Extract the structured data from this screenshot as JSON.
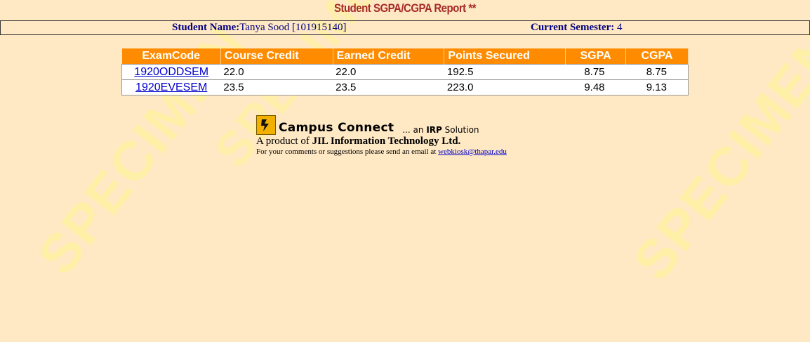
{
  "page": {
    "title": "Student SGPA/CGPA Report **",
    "watermark": "SPECIMEN"
  },
  "info": {
    "student_name_label": "Student Name:",
    "student_name_value": "Tanya Sood [101915140]",
    "semester_label": "Current Semester:",
    "semester_value": "4"
  },
  "table": {
    "headers": [
      "ExamCode",
      "Course Credit",
      "Earned Credit",
      "Points Secured",
      "SGPA",
      "CGPA"
    ],
    "rows": [
      {
        "exam_code": "1920ODDSEM",
        "course_credit": "22.0",
        "earned_credit": "22.0",
        "points_secured": "192.5",
        "sgpa": "8.75",
        "cgpa": "8.75"
      },
      {
        "exam_code": "1920EVESEM",
        "course_credit": "23.5",
        "earned_credit": "23.5",
        "points_secured": "223.0",
        "sgpa": "9.48",
        "cgpa": "9.13"
      }
    ]
  },
  "footer": {
    "brand": "Campus Connect",
    "tag_prefix": "... an",
    "tag_bold": "IRP",
    "tag_suffix": "Solution",
    "product_prefix": "A product of",
    "product_company": "JIL Information Technology Ltd.",
    "comments_text": "For your comments or suggestions please send an email at",
    "email": "webkiosk@thapar.edu"
  },
  "colors": {
    "background": "#ffe8c4",
    "header_orange": "#ff8c00",
    "title_red": "#a52a2a",
    "info_navy": "#000080",
    "link_blue": "#0000cc"
  }
}
